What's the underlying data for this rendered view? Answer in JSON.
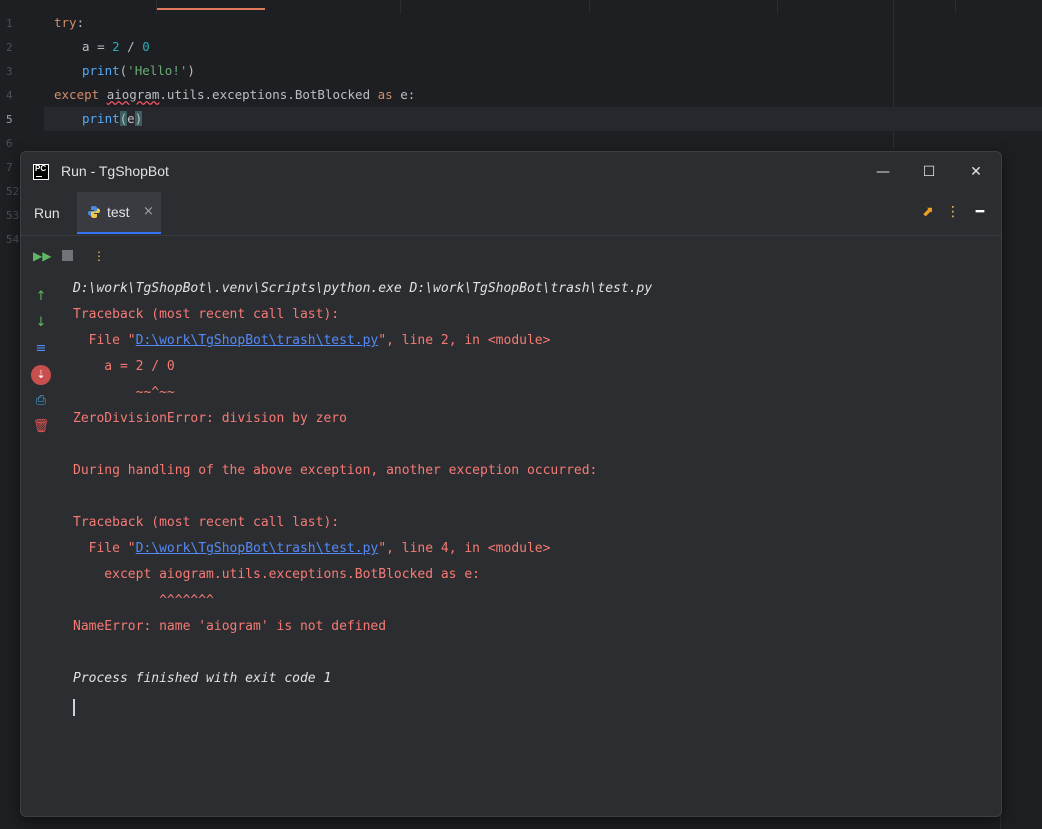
{
  "editor": {
    "gutter_numbers": [
      "1",
      "2",
      "3",
      "4",
      "5",
      "6",
      "7",
      "52",
      "53",
      "54"
    ],
    "lines": {
      "l1_kw": "try",
      "l1_rest": ":",
      "l2_a": "a ",
      "l2_eq": "= ",
      "l2_n1": "2",
      "l2_div": " / ",
      "l2_n2": "0",
      "l3_fn": "print",
      "l3_open": "(",
      "l3_str": "'Hello!'",
      "l3_close": ")",
      "l4_kw": "except ",
      "l4_mod": "aiogram",
      "l4_rest": ".utils.exceptions.BotBlocked ",
      "l4_as": "as",
      "l4_e": " e:",
      "l5_fn": "print",
      "l5_open": "(",
      "l5_arg": "e",
      "l5_close": ")"
    }
  },
  "run_window": {
    "title": "Run - TgShopBot",
    "logo_text": "PC",
    "minimize": "—",
    "maximize": "☐",
    "close": "✕",
    "run_label": "Run",
    "tab_label": "test",
    "tab_close": "×",
    "colors": {
      "accent": "#3574f0",
      "error_text": "#f77a74",
      "link": "#548af7"
    }
  },
  "console": {
    "cmd": "D:\\work\\TgShopBot\\.venv\\Scripts\\python.exe D:\\work\\TgShopBot\\trash\\test.py",
    "tb1": "Traceback (most recent call last):",
    "file1_pre": "  File \"",
    "file1_link": "D:\\work\\TgShopBot\\trash\\test.py",
    "file1_post": "\", line 2, in <module>",
    "code1": "    a = 2 / 0",
    "caret1": "        ~~^~~",
    "err1": "ZeroDivisionError: division by zero",
    "during": "During handling of the above exception, another exception occurred:",
    "tb2": "Traceback (most recent call last):",
    "file2_pre": "  File \"",
    "file2_link": "D:\\work\\TgShopBot\\trash\\test.py",
    "file2_post": "\", line 4, in <module>",
    "code2": "    except aiogram.utils.exceptions.BotBlocked as e:",
    "caret2": "           ^^^^^^^",
    "err2": "NameError: name 'aiogram' is not defined",
    "done": "Process finished with exit code 1"
  }
}
